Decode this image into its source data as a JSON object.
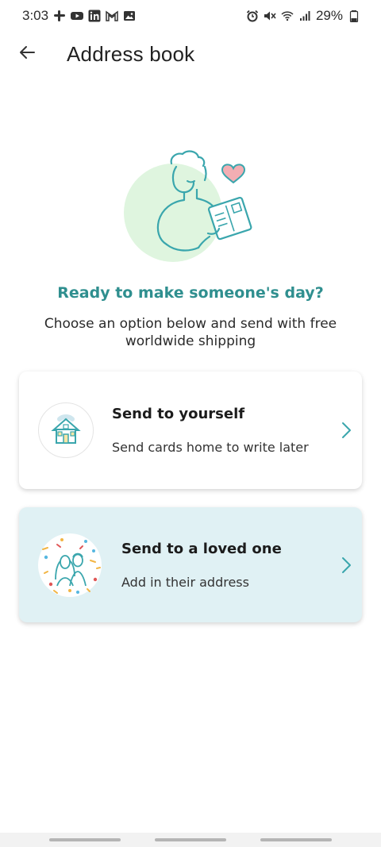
{
  "status_bar": {
    "time": "3:03",
    "battery": "29%",
    "left_icons": [
      "slack-icon",
      "youtube-icon",
      "linkedin-icon",
      "gmail-icon",
      "gallery-icon"
    ],
    "right_icons": [
      "alarm-icon",
      "mute-icon",
      "wifi-icon",
      "signal-icon",
      "battery-icon"
    ]
  },
  "app_bar": {
    "title": "Address book",
    "back_icon": "arrow-left-icon"
  },
  "hero": {
    "headline": "Ready to make someone's day?",
    "subtext": "Choose an option below and send with free worldwide shipping"
  },
  "options": [
    {
      "title": "Send to yourself",
      "subtitle": "Send cards home to write later",
      "icon": "house-icon"
    },
    {
      "title": "Send to a loved one",
      "subtitle": "Add in their address",
      "icon": "couple-confetti-icon"
    }
  ],
  "colors": {
    "accent": "#2f8f8f",
    "illustration_line": "#3aa6ad",
    "illustration_blob": "#dff5df",
    "heart": "#f3aeb3",
    "loved_card_bg": "#e0f1f4"
  }
}
